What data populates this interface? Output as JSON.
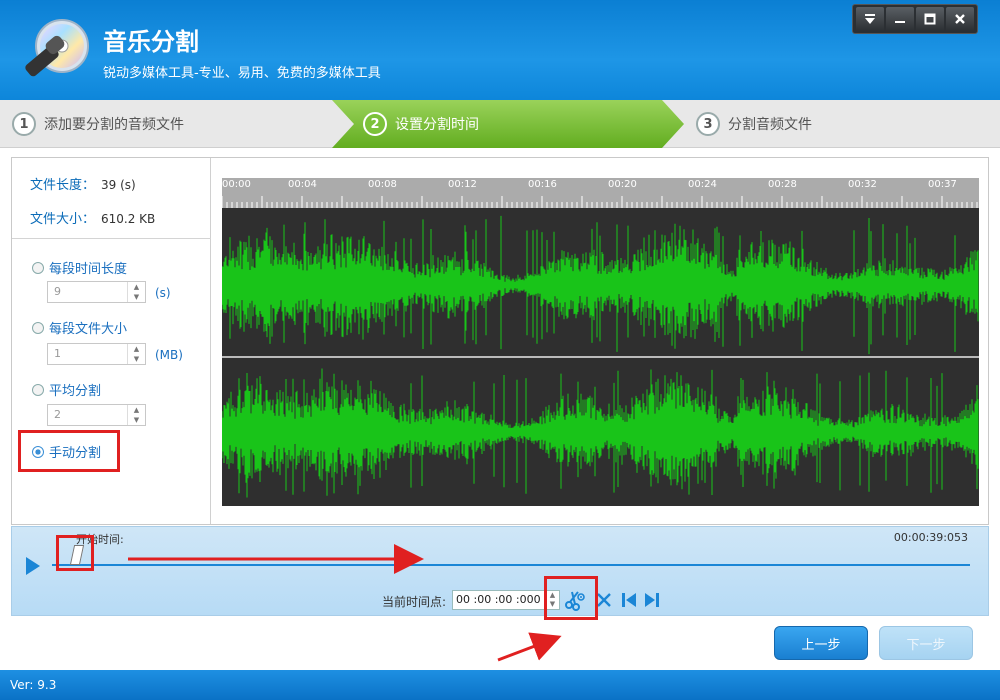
{
  "app": {
    "title": "音乐分割",
    "subtitle": "锐动多媒体工具-专业、易用、免费的多媒体工具",
    "version": "Ver: 9.3"
  },
  "window_controls": [
    "menu-icon",
    "minimize-icon",
    "maximize-icon",
    "close-icon"
  ],
  "steps": [
    {
      "num": "1",
      "label": "添加要分割的音频文件",
      "active": false
    },
    {
      "num": "2",
      "label": "设置分割时间",
      "active": true
    },
    {
      "num": "3",
      "label": "分割音频文件",
      "active": false
    }
  ],
  "file_info": {
    "length_label": "文件长度：",
    "length_value": "39 (s)",
    "size_label": "文件大小：",
    "size_value": "610.2 KB"
  },
  "split_options": {
    "per_duration": {
      "label": "每段时间长度",
      "value": "9",
      "unit": "(s)"
    },
    "per_size": {
      "label": "每段文件大小",
      "value": "1",
      "unit": "(MB)"
    },
    "average": {
      "label": "平均分割",
      "value": "2"
    },
    "manual": {
      "label": "手动分割",
      "checked": true
    }
  },
  "ruler_ticks": [
    "00:00",
    "00:04",
    "00:08",
    "00:12",
    "00:16",
    "00:20",
    "00:24",
    "00:28",
    "00:32",
    "00:37"
  ],
  "timeline": {
    "start_label": "开始时间:",
    "end_time": "00:00:39:053",
    "current_label": "当前时间点:",
    "current_value": "00 :00 :00 :000"
  },
  "buttons": {
    "prev": "上一步",
    "next": "下一步"
  },
  "colors": {
    "header_blue": "#1e96e6",
    "step_active_green": "#7cc23a",
    "wave_green": "#19c419",
    "wave_bg": "#2f2f2f",
    "highlight_red": "#e02020"
  }
}
